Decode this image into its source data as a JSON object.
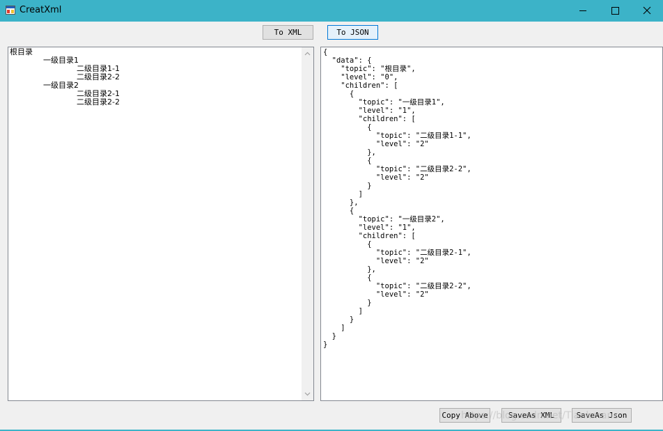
{
  "window": {
    "title": "CreatXml",
    "accent": "#3cb3c8"
  },
  "toolbar": {
    "to_xml_label": "To XML",
    "to_json_label": "To JSON"
  },
  "tree": {
    "root": "根目录",
    "nodes": [
      {
        "label": "一级目录1",
        "level": 1
      },
      {
        "label": "二级目录1-1",
        "level": 2
      },
      {
        "label": "二级目录2-2",
        "level": 2
      },
      {
        "label": "一级目录2",
        "level": 1
      },
      {
        "label": "二级目录2-1",
        "level": 2
      },
      {
        "label": "二级目录2-2",
        "level": 2
      }
    ]
  },
  "json_output": "{\n  \"data\": {\n    \"topic\": \"根目录\",\n    \"level\": \"0\",\n    \"children\": [\n      {\n        \"topic\": \"一级目录1\",\n        \"level\": \"1\",\n        \"children\": [\n          {\n            \"topic\": \"二级目录1-1\",\n            \"level\": \"2\"\n          },\n          {\n            \"topic\": \"二级目录2-2\",\n            \"level\": \"2\"\n          }\n        ]\n      },\n      {\n        \"topic\": \"一级目录2\",\n        \"level\": \"1\",\n        \"children\": [\n          {\n            \"topic\": \"二级目录2-1\",\n            \"level\": \"2\"\n          },\n          {\n            \"topic\": \"二级目录2-2\",\n            \"level\": \"2\"\n          }\n        ]\n      }\n    ]\n  }\n}",
  "footer": {
    "copy_label": "Copy Above",
    "save_xml_label": "SaveAs XML",
    "save_json_label": "SaveAs Json"
  },
  "watermark": "https://blog.csdn.net/Tiankmans",
  "icons": {
    "app": "app-window-icon",
    "minimize": "minimize-icon",
    "maximize": "maximize-icon",
    "close": "close-icon"
  }
}
